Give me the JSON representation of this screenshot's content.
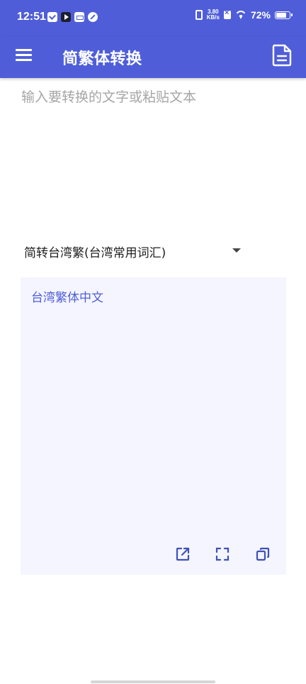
{
  "status_bar": {
    "time": "12:51",
    "net_speed_value": "3.80",
    "net_speed_unit": "KB/s",
    "battery": "72%"
  },
  "app_bar": {
    "title": "简繁体转换"
  },
  "input": {
    "placeholder": "输入要转换的文字或粘贴文本",
    "value": ""
  },
  "mode_select": {
    "selected": "简转台湾繁(台湾常用词汇)"
  },
  "output": {
    "text": "台湾繁体中文"
  },
  "colors": {
    "primary": "#4F5ED8",
    "output_background": "#F4F5FF",
    "placeholder": "#A6A6A6"
  },
  "icons": {
    "menu": "hamburger-menu-icon",
    "document": "document-icon",
    "share": "share-external-icon",
    "fullscreen": "fullscreen-icon",
    "copy": "copy-icon"
  }
}
